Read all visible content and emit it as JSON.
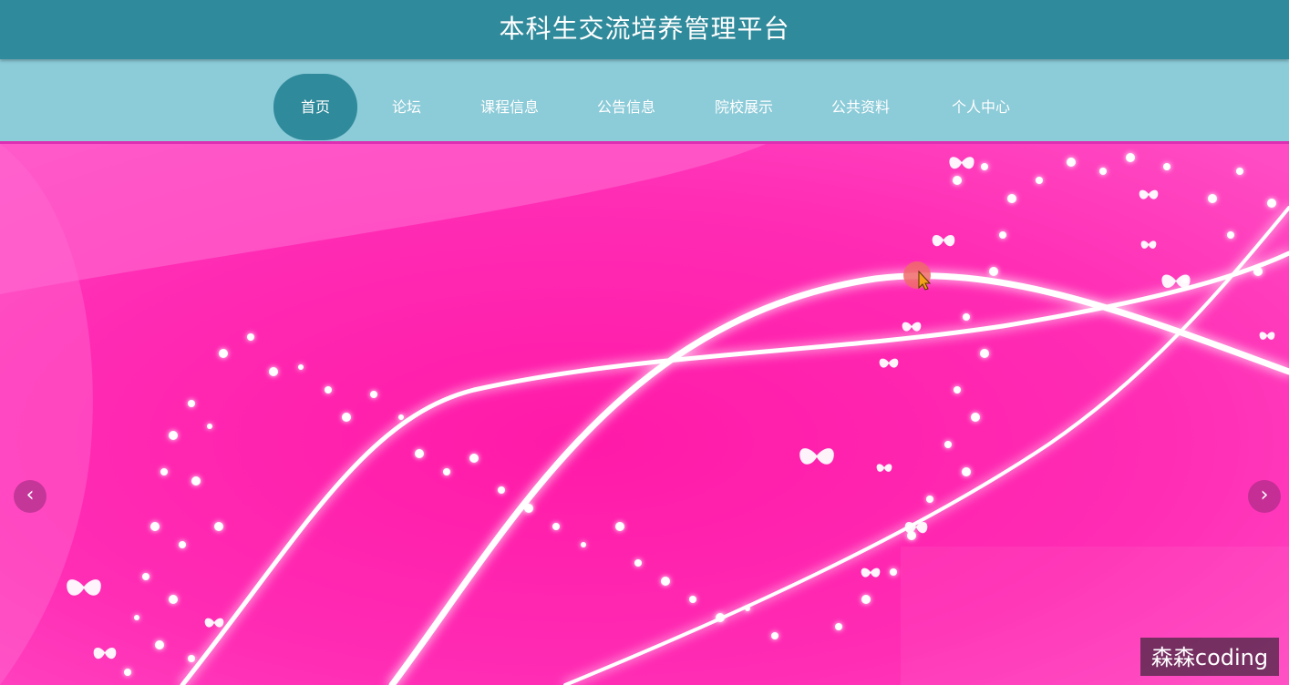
{
  "header": {
    "title": "本科生交流培养管理平台"
  },
  "nav": {
    "items": [
      {
        "label": "首页",
        "active": true
      },
      {
        "label": "论坛",
        "active": false
      },
      {
        "label": "课程信息",
        "active": false
      },
      {
        "label": "公告信息",
        "active": false
      },
      {
        "label": "院校展示",
        "active": false
      },
      {
        "label": "公共资料",
        "active": false
      },
      {
        "label": "个人中心",
        "active": false
      }
    ]
  },
  "banner": {
    "prev_icon": "‹",
    "next_icon": "›"
  },
  "watermark": {
    "text": "森森coding"
  },
  "colors": {
    "header_bg": "#2f8a9b",
    "nav_bg": "#8ccbd8",
    "banner_pink": "#ff30b8"
  }
}
